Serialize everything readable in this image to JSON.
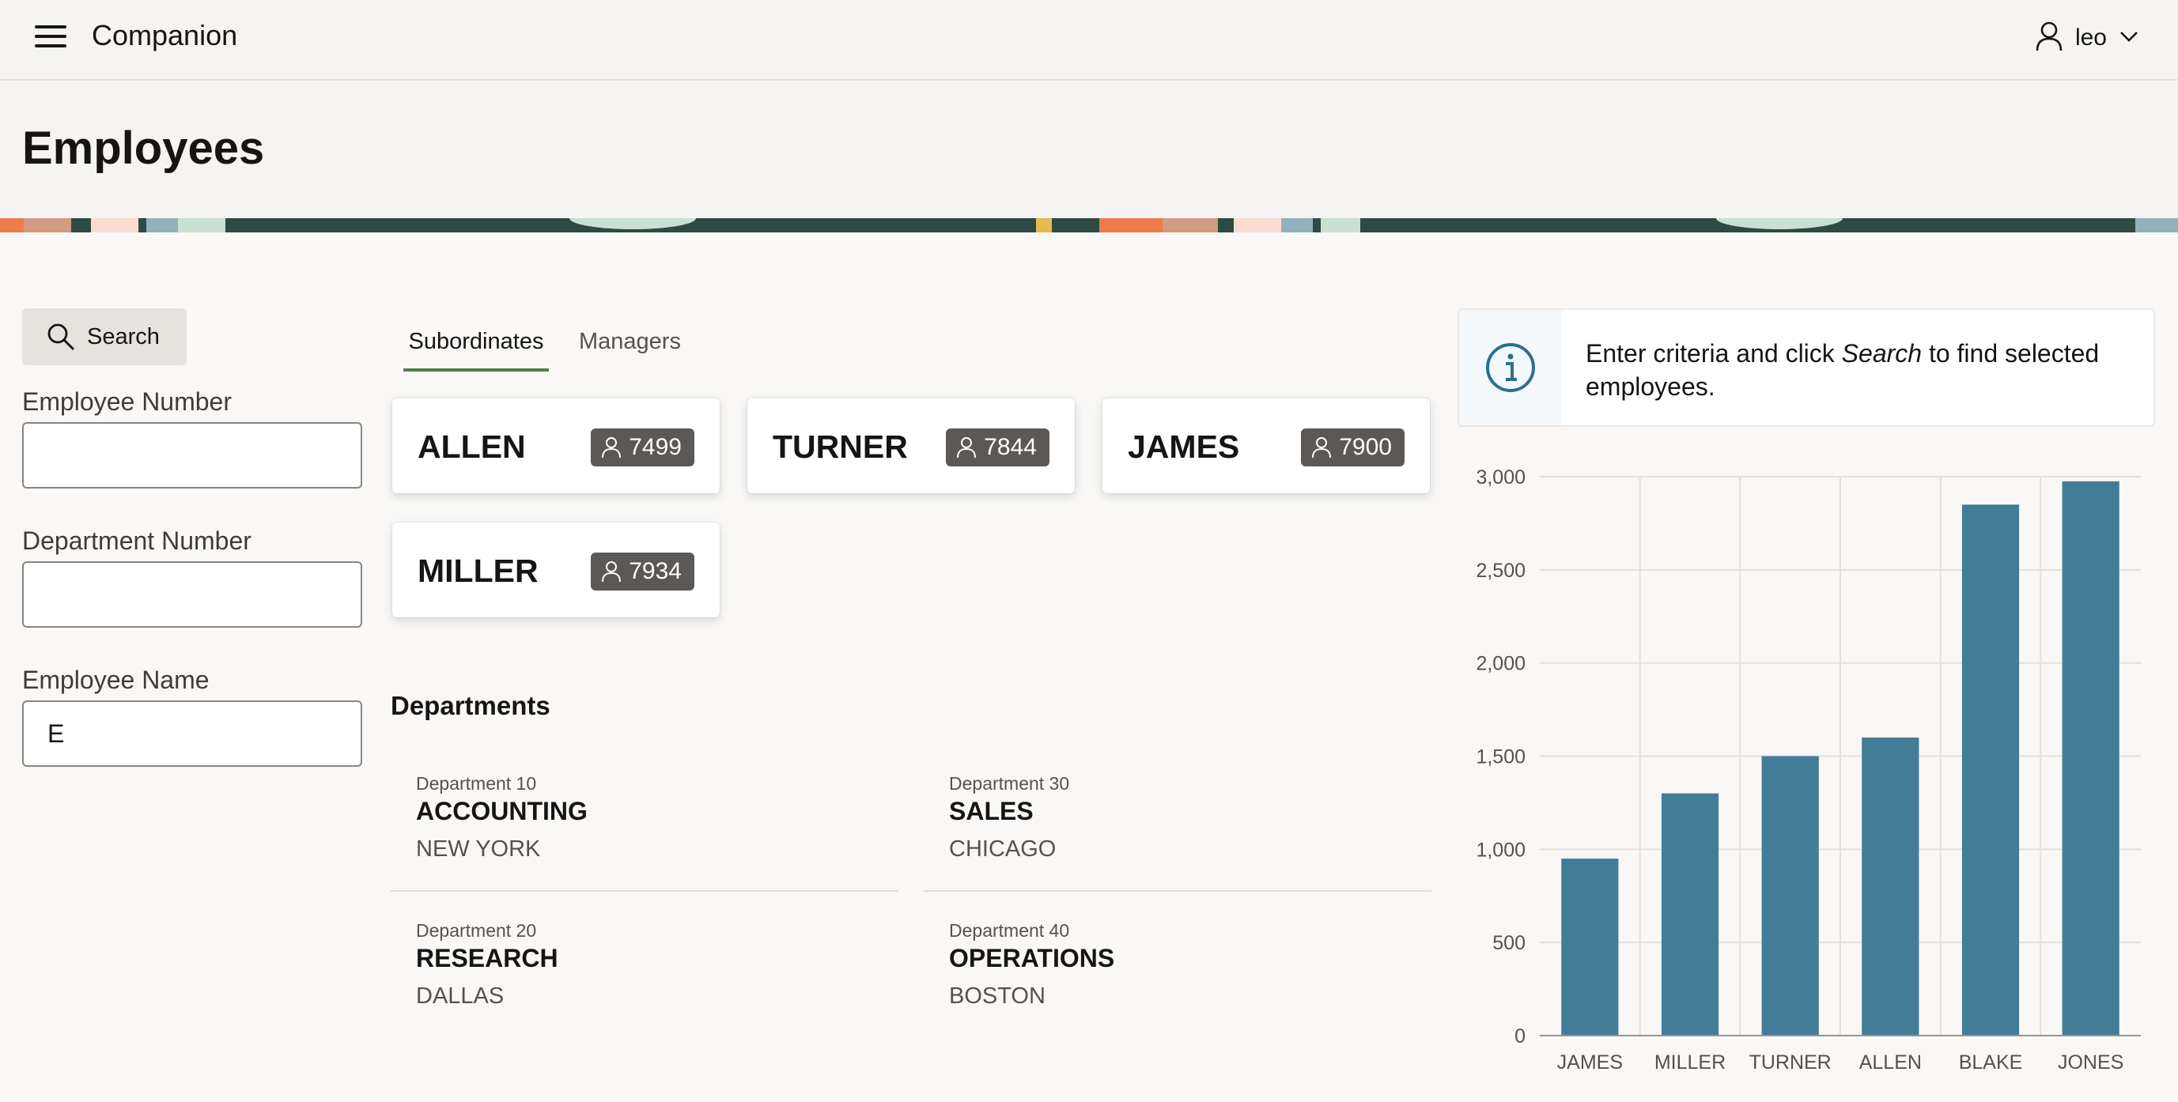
{
  "header": {
    "app_title": "Companion",
    "user_name": "leo",
    "menu_icon": "hamburger-menu-icon",
    "user_icon": "user-icon",
    "dropdown_icon": "chevron-down-icon"
  },
  "page": {
    "title": "Employees"
  },
  "search_form": {
    "search_button_label": "Search",
    "fields": [
      {
        "label": "Employee Number",
        "value": ""
      },
      {
        "label": "Department Number",
        "value": ""
      },
      {
        "label": "Employee Name",
        "value": "E"
      }
    ]
  },
  "tabs": [
    {
      "label": "Subordinates",
      "active": true
    },
    {
      "label": "Managers",
      "active": false
    }
  ],
  "employees": [
    {
      "name": "ALLEN",
      "number": "7499"
    },
    {
      "name": "TURNER",
      "number": "7844"
    },
    {
      "name": "JAMES",
      "number": "7900"
    },
    {
      "name": "MILLER",
      "number": "7934"
    }
  ],
  "departments": {
    "heading": "Departments",
    "items": [
      {
        "number_label": "Department 10",
        "name": "ACCOUNTING",
        "location": "NEW YORK"
      },
      {
        "number_label": "Department 30",
        "name": "SALES",
        "location": "CHICAGO"
      },
      {
        "number_label": "Department 20",
        "name": "RESEARCH",
        "location": "DALLAS"
      },
      {
        "number_label": "Department 40",
        "name": "OPERATIONS",
        "location": "BOSTON"
      }
    ]
  },
  "info": {
    "text_before": "Enter criteria and click ",
    "text_emphasis": "Search",
    "text_after": " to find selected employees."
  },
  "colors": {
    "bar": "#437c97",
    "tab_underline": "#587c48",
    "info_icon": "#2b6f8e",
    "badge": "#5b5855"
  },
  "chart_data": {
    "type": "bar",
    "categories": [
      "JAMES",
      "MILLER",
      "TURNER",
      "ALLEN",
      "BLAKE",
      "JONES"
    ],
    "values": [
      950,
      1300,
      1500,
      1600,
      2850,
      2975
    ],
    "ylim": [
      0,
      3000
    ],
    "yticks": [
      0,
      500,
      1000,
      1500,
      2000,
      2500,
      3000
    ],
    "ytick_labels": [
      "0",
      "500",
      "1,000",
      "1,500",
      "2,000",
      "2,500",
      "3,000"
    ],
    "grid": true,
    "title": "",
    "xlabel": "",
    "ylabel": ""
  }
}
